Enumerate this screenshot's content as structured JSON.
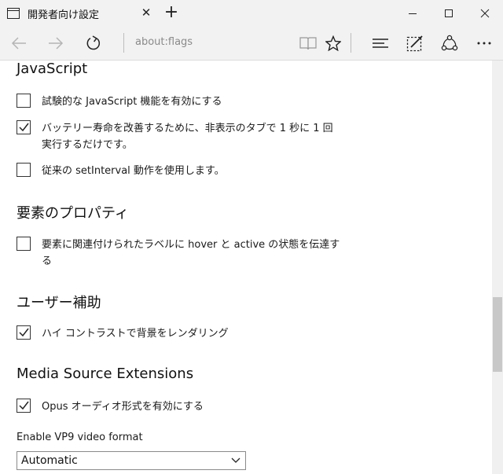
{
  "window": {
    "tab_title": "開発者向け設定",
    "tab_close": "✕",
    "new_tab": "+"
  },
  "toolbar": {
    "address": "about:flags"
  },
  "sections": {
    "javascript": {
      "heading": "JavaScript",
      "options": [
        {
          "label": "試験的な JavaScript 機能を有効にする",
          "checked": false
        },
        {
          "label": "バッテリー寿命を改善するために、非表示のタブで 1 秒に 1 回実行するだけです。",
          "checked": true
        },
        {
          "label": "従来の setInterval 動作を使用します。",
          "checked": false
        }
      ]
    },
    "element_props": {
      "heading": "要素のプロパティ",
      "options": [
        {
          "label": "要素に関連付けられたラベルに hover と active の状態を伝達する",
          "checked": false
        }
      ]
    },
    "accessibility": {
      "heading": "ユーザー補助",
      "options": [
        {
          "label": "ハイ コントラストで背景をレンダリング",
          "checked": true
        }
      ]
    },
    "mse": {
      "heading": "Media Source Extensions",
      "options": [
        {
          "label": "Opus オーディオ形式を有効にする",
          "checked": true
        }
      ],
      "vp9_label": "Enable VP9 video format",
      "vp9_value": "Automatic"
    }
  },
  "colors": {
    "chrome_bg": "#f2f2f2",
    "text": "#1a1a1a",
    "checkbox_border": "#333333"
  }
}
